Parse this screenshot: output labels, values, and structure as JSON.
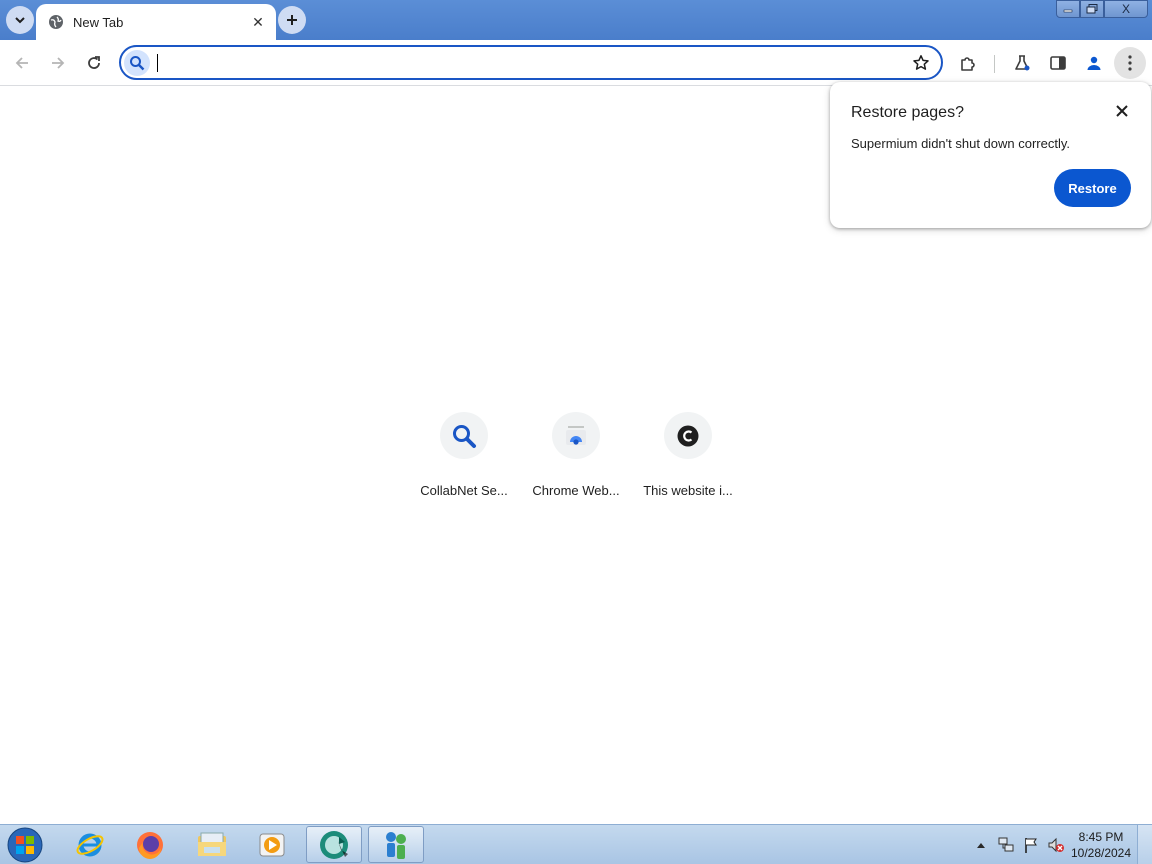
{
  "browser": {
    "tab_search_icon": "chevron-down-icon",
    "tabs": [
      {
        "title": "New Tab",
        "favicon": "globe-icon"
      }
    ],
    "new_tab_icon": "plus-icon",
    "window_controls": {
      "minimize": "minimize-icon",
      "maximize": "restore-icon",
      "close": "X"
    }
  },
  "toolbar": {
    "back_icon": "arrow-left-icon",
    "forward_icon": "arrow-right-icon",
    "reload_icon": "reload-icon",
    "omnibox": {
      "value": "",
      "placeholder": "",
      "icon": "search-icon",
      "bookmark_icon": "star-icon"
    },
    "extensions_icon": "puzzle-icon",
    "labs_icon": "flask-icon",
    "side_panel_icon": "side-panel-icon",
    "profile_icon": "person-icon",
    "menu_icon": "kebab-menu-icon"
  },
  "restore_popup": {
    "title": "Restore pages?",
    "message": "Supermium didn't shut down correctly.",
    "button_label": "Restore"
  },
  "shortcuts": [
    {
      "label": "CollabNet Se...",
      "icon": "search-icon"
    },
    {
      "label": "Chrome Web...",
      "icon": "chrome-web-store-icon"
    },
    {
      "label": "This website i...",
      "icon": "c-letter-icon"
    }
  ],
  "taskbar": {
    "apps": [
      "internet-explorer-icon",
      "firefox-icon",
      "file-explorer-icon",
      "media-player-icon",
      "supermium-icon",
      "network-people-icon"
    ],
    "tray": [
      "tray-arrow-icon",
      "network-icon",
      "action-center-flag-icon",
      "volume-muted-icon"
    ],
    "time": "8:45 PM",
    "date": "10/28/2024"
  },
  "colors": {
    "accent": "#0b57d0",
    "omnibox_border": "#1a56c5",
    "titlebar": "#4a7ecb"
  }
}
